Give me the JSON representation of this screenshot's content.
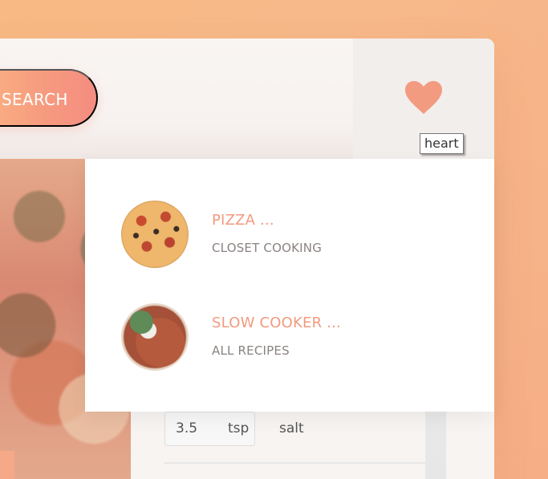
{
  "search": {
    "button_label": "SEARCH"
  },
  "bookmarks": {
    "tooltip": "heart",
    "items": [
      {
        "title": "PIZZA ...",
        "publisher": "CLOSET COOKING",
        "thumbnail": "pizza"
      },
      {
        "title": "SLOW COOKER ...",
        "publisher": "ALL RECIPES",
        "thumbnail": "soup"
      }
    ]
  },
  "ingredients": [
    {
      "quantity": "3.5",
      "unit": "tsp",
      "name": "salt"
    }
  ],
  "icons": {
    "bookmark_toggle": "heart-icon"
  },
  "colors": {
    "accent": "#f29a7e",
    "accent_light": "#fbb682",
    "background": "#f8b984"
  }
}
